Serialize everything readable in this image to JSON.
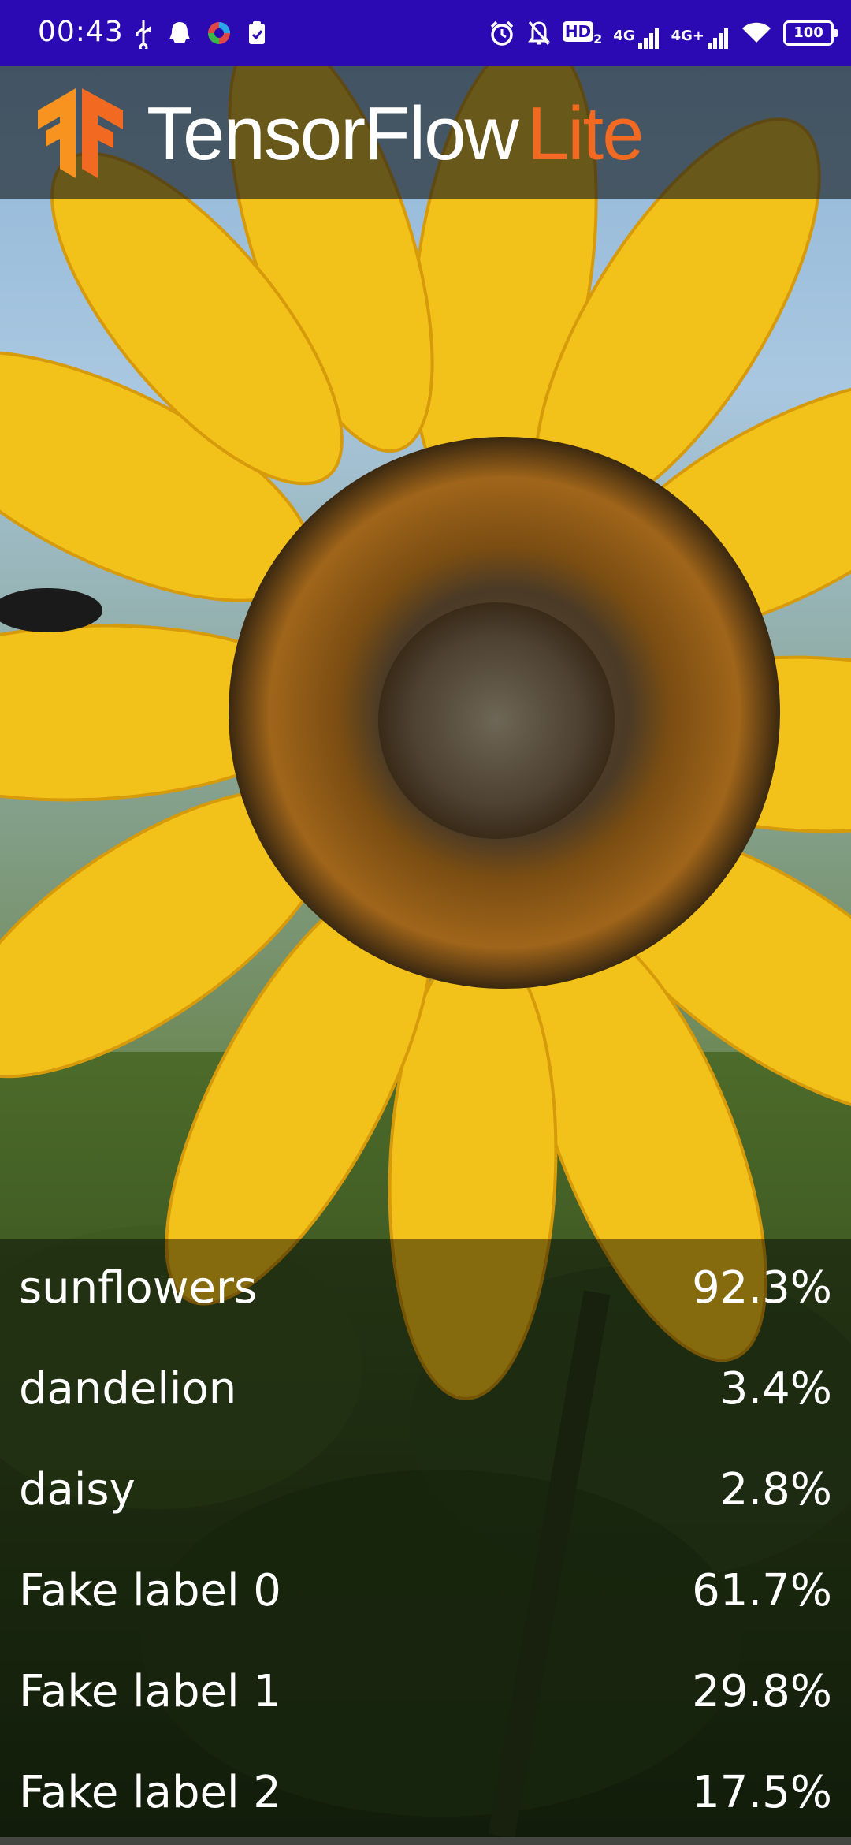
{
  "status_bar": {
    "time": "00:43",
    "left_icons": [
      "usb-icon",
      "qq-icon",
      "app-switch-icon",
      "clipboard-check-icon"
    ],
    "right_icons": [
      "alarm-icon",
      "notifications-off-icon",
      "hd-voice-icon",
      "signal-4g-icon",
      "signal-4g-plus-icon",
      "wifi-icon",
      "battery-icon"
    ],
    "hd_label": "HD",
    "hd_sub": "2",
    "network_1": "4G",
    "network_2": "4G+",
    "battery_level": "100"
  },
  "header": {
    "brand_main": "TensorFlow",
    "brand_sub": "Lite",
    "logo_icon": "tensorflow-logo-icon",
    "colors": {
      "logo_orange": "#f7931e",
      "lite_orange": "#f26a21",
      "status_bar": "#2c0ab3"
    }
  },
  "camera": {
    "subject": "camera-preview"
  },
  "results": [
    {
      "label": "sunflowers",
      "score": "92.3%"
    },
    {
      "label": "dandelion",
      "score": "3.4%"
    },
    {
      "label": "daisy",
      "score": "2.8%"
    },
    {
      "label": "Fake label 0",
      "score": "61.7%"
    },
    {
      "label": "Fake label 1",
      "score": "29.8%"
    },
    {
      "label": "Fake label 2",
      "score": "17.5%"
    }
  ]
}
